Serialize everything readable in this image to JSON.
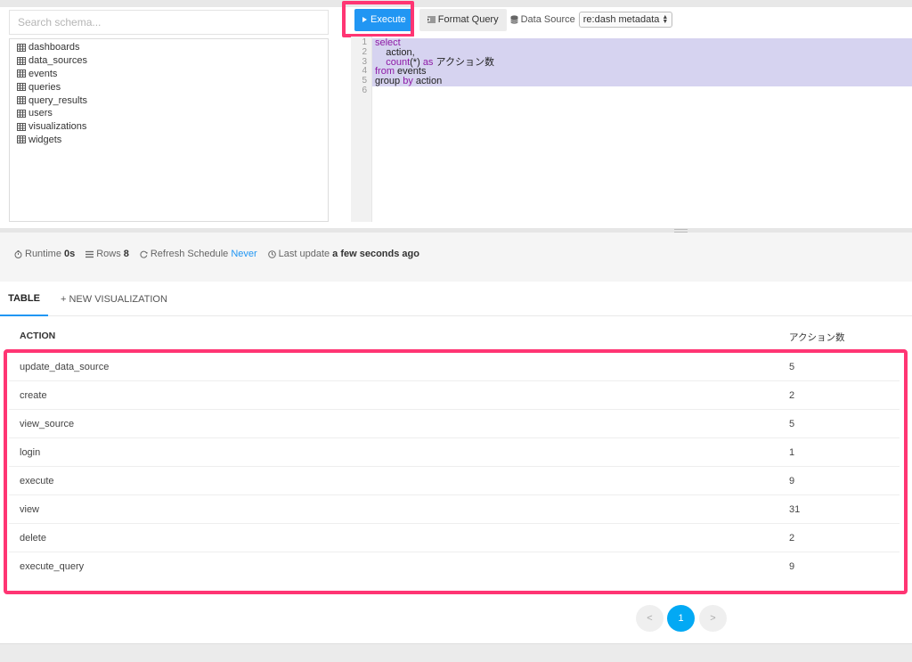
{
  "schema": {
    "search_placeholder": "Search schema...",
    "tables": [
      "dashboards",
      "data_sources",
      "events",
      "queries",
      "query_results",
      "users",
      "visualizations",
      "widgets"
    ]
  },
  "toolbar": {
    "execute_label": "Execute",
    "format_label": "Format Query",
    "datasource_label": "Data Source",
    "datasource_value": "re:dash metadata"
  },
  "editor": {
    "line_numbers": [
      "1",
      "2",
      "3",
      "4",
      "5",
      "6"
    ],
    "lines": [
      {
        "a": "select",
        "b": ""
      },
      {
        "a": "    action,",
        "b": ""
      },
      {
        "a": "    count",
        "b": "(*) "
      },
      {
        "a": "from",
        "b": " events"
      },
      {
        "a": "group",
        "b": " "
      },
      {
        "a": "",
        "b": ""
      }
    ],
    "line3_as": "as",
    "line3_alias": " アクション数",
    "line5_by": "by",
    "line5_rest": " action"
  },
  "meta": {
    "runtime_label": "Runtime",
    "runtime_value": "0s",
    "rows_label": "Rows",
    "rows_value": "8",
    "refresh_label": "Refresh Schedule",
    "refresh_value": "Never",
    "last_update_label": "Last update",
    "last_update_value": "a few seconds ago"
  },
  "tabs": {
    "table": "TABLE",
    "new_visualization": "+ NEW VISUALIZATION"
  },
  "results": {
    "columns": [
      "ACTION",
      "アクション数"
    ],
    "rows": [
      [
        "update_data_source",
        "5"
      ],
      [
        "create",
        "2"
      ],
      [
        "view_source",
        "5"
      ],
      [
        "login",
        "1"
      ],
      [
        "execute",
        "9"
      ],
      [
        "view",
        "31"
      ],
      [
        "delete",
        "2"
      ],
      [
        "execute_query",
        "9"
      ]
    ]
  },
  "pagination": {
    "prev": "<",
    "current": "1",
    "next": ">"
  },
  "colors": {
    "accent": "#2196f3",
    "highlight": "#ff3573",
    "selection": "#d6d3f0"
  }
}
